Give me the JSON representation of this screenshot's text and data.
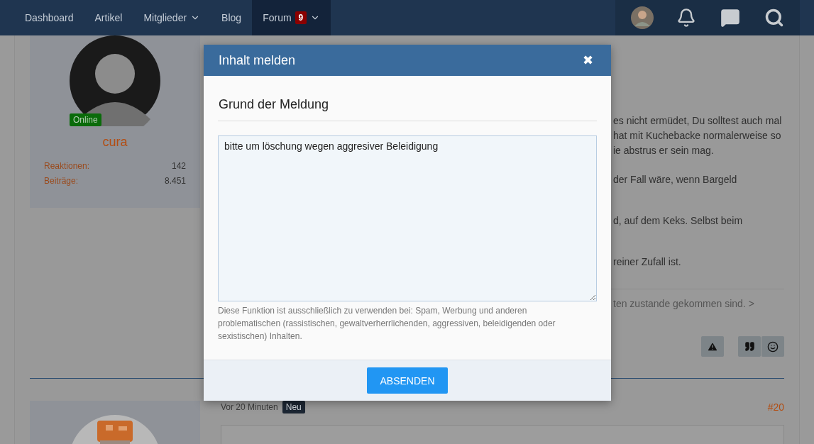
{
  "nav": {
    "items": [
      {
        "label": "Dashboard",
        "dropdown": false,
        "selected": false
      },
      {
        "label": "Artikel",
        "dropdown": false,
        "selected": false
      },
      {
        "label": "Mitglieder",
        "dropdown": true,
        "selected": false
      },
      {
        "label": "Blog",
        "dropdown": false,
        "selected": false
      },
      {
        "label": "Forum",
        "badge": "9",
        "dropdown": true,
        "selected": true
      }
    ]
  },
  "posts": [
    {
      "user": {
        "name": "cura",
        "status": "Online",
        "stats": [
          {
            "label": "Reaktionen:",
            "value": "142"
          },
          {
            "label": "Beiträge:",
            "value": "8.451"
          }
        ]
      },
      "paragraphs": [
        [
          "es nicht ermüdet, Du solltest auch mal",
          "hat mit Kuchebacke normalerweise so",
          "ie abstrus er sein mag."
        ],
        [
          "der Fall wäre, wenn Bargeld"
        ],
        [
          "d, auf dem Keks. Selbst beim"
        ],
        [
          "reiner Zufall ist."
        ]
      ],
      "link": "ten zustande gekommen sind. >"
    },
    {
      "time": "Vor 20 Minuten",
      "badge": "Neu",
      "number": "#20"
    }
  ],
  "modal": {
    "title": "Inhalt melden",
    "close": "✖",
    "section_title": "Grund der Meldung",
    "reason": "bitte um löschung wegen aggresiver Beleidigung",
    "hint": "Diese Funktion ist ausschließlich zu verwenden bei: Spam, Werbung und anderen problematischen (rassistischen, gewaltverherrlichenden, aggressiven, beleidigenden oder sexistischen) Inhalten.",
    "submit": "ABSENDEN"
  }
}
